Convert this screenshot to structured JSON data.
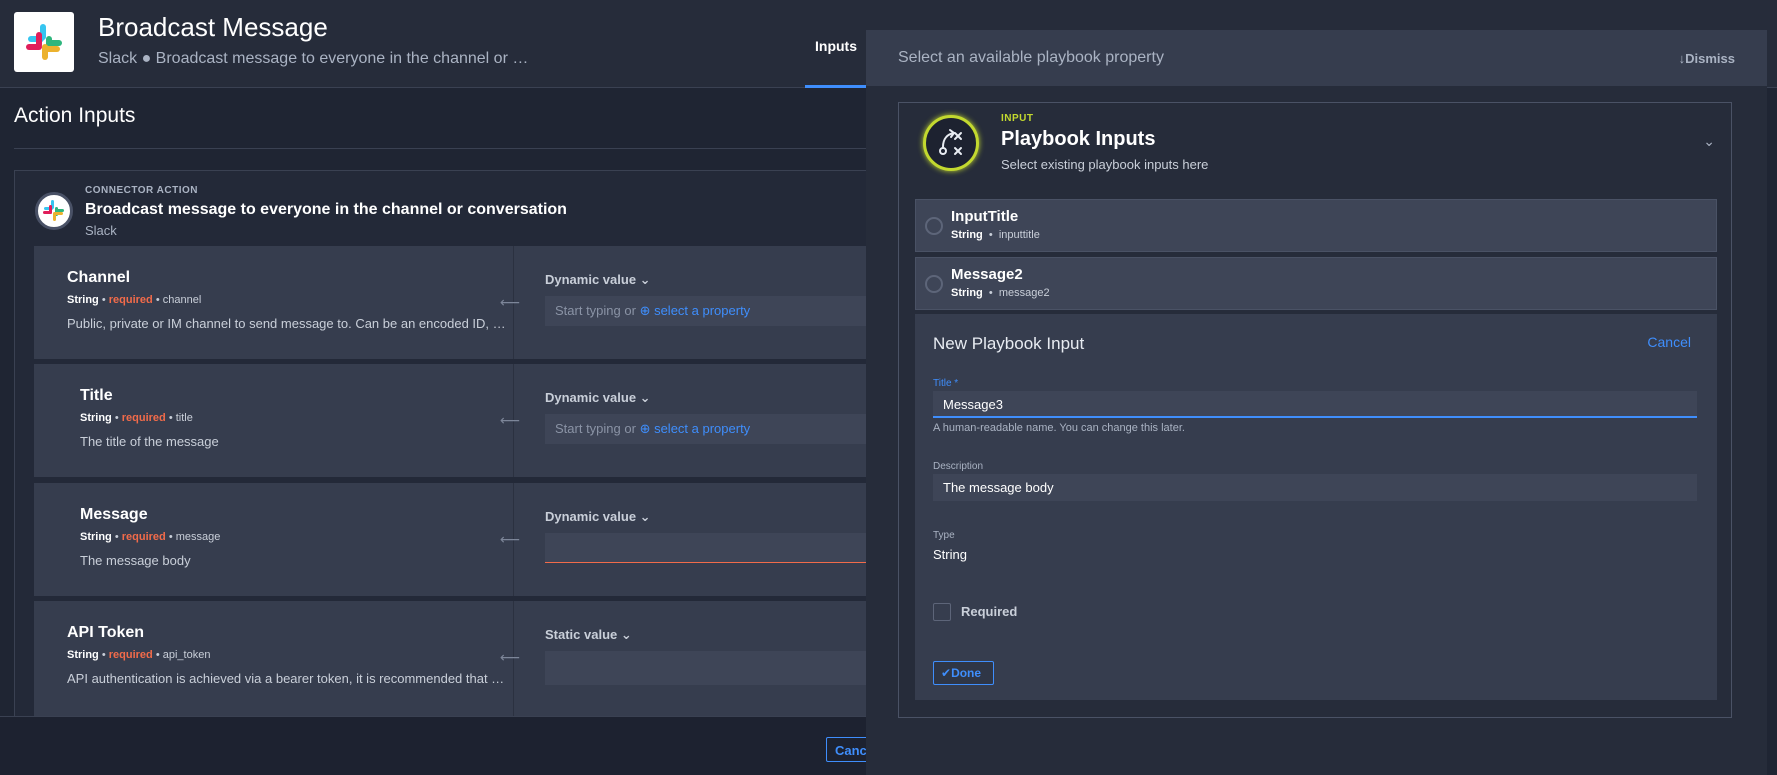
{
  "header": {
    "title": "Broadcast Message",
    "subtitle": "Slack ● Broadcast message to everyone in the channel or …",
    "tab_inputs": "Inputs"
  },
  "action_inputs": {
    "title": "Action Inputs",
    "connector_kicker": "CONNECTOR ACTION",
    "connector_title": "Broadcast message to everyone in the channel or conversation",
    "connector_sub": "Slack",
    "rows": [
      {
        "name": "Channel",
        "type": "String",
        "required": "required",
        "key": "channel",
        "desc": "Public, private or IM channel to send message to. Can be an encoded ID, o…",
        "mode": "Dynamic value",
        "placeholder_pre": "Start typing or",
        "placeholder_link": "select a property"
      },
      {
        "name": "Title",
        "type": "String",
        "required": "required",
        "key": "title",
        "desc": "The title of the message",
        "mode": "Dynamic value",
        "placeholder_pre": "Start typing or",
        "placeholder_link": "select a property"
      },
      {
        "name": "Message",
        "type": "String",
        "required": "required",
        "key": "message",
        "desc": "The message body",
        "mode": "Dynamic value"
      },
      {
        "name": "API Token",
        "type": "String",
        "required": "required",
        "key": "api_token",
        "desc": "API authentication is achieved via a bearer token, it is recommended that …",
        "mode": "Static value"
      }
    ],
    "cancel": "Cancel"
  },
  "panel": {
    "title": "Select an available playbook property",
    "dismiss": "Dismiss",
    "kicker": "INPUT",
    "heading": "Playbook Inputs",
    "sub": "Select existing playbook inputs here",
    "options": [
      {
        "name": "InputTitle",
        "type": "String",
        "key": "inputtitle"
      },
      {
        "name": "Message2",
        "type": "String",
        "key": "message2"
      }
    ],
    "form": {
      "title": "New Playbook Input",
      "cancel": "Cancel",
      "title_label": "Title *",
      "title_value": "Message3",
      "title_hint": "A human-readable name. You can change this later.",
      "desc_label": "Description",
      "desc_value": "The message body",
      "type_label": "Type",
      "type_value": "String",
      "required_label": "Required",
      "done": "Done"
    }
  },
  "colors": {
    "accent": "#3f8efc",
    "required": "#f26b4a",
    "playbook": "#c3d92f"
  }
}
